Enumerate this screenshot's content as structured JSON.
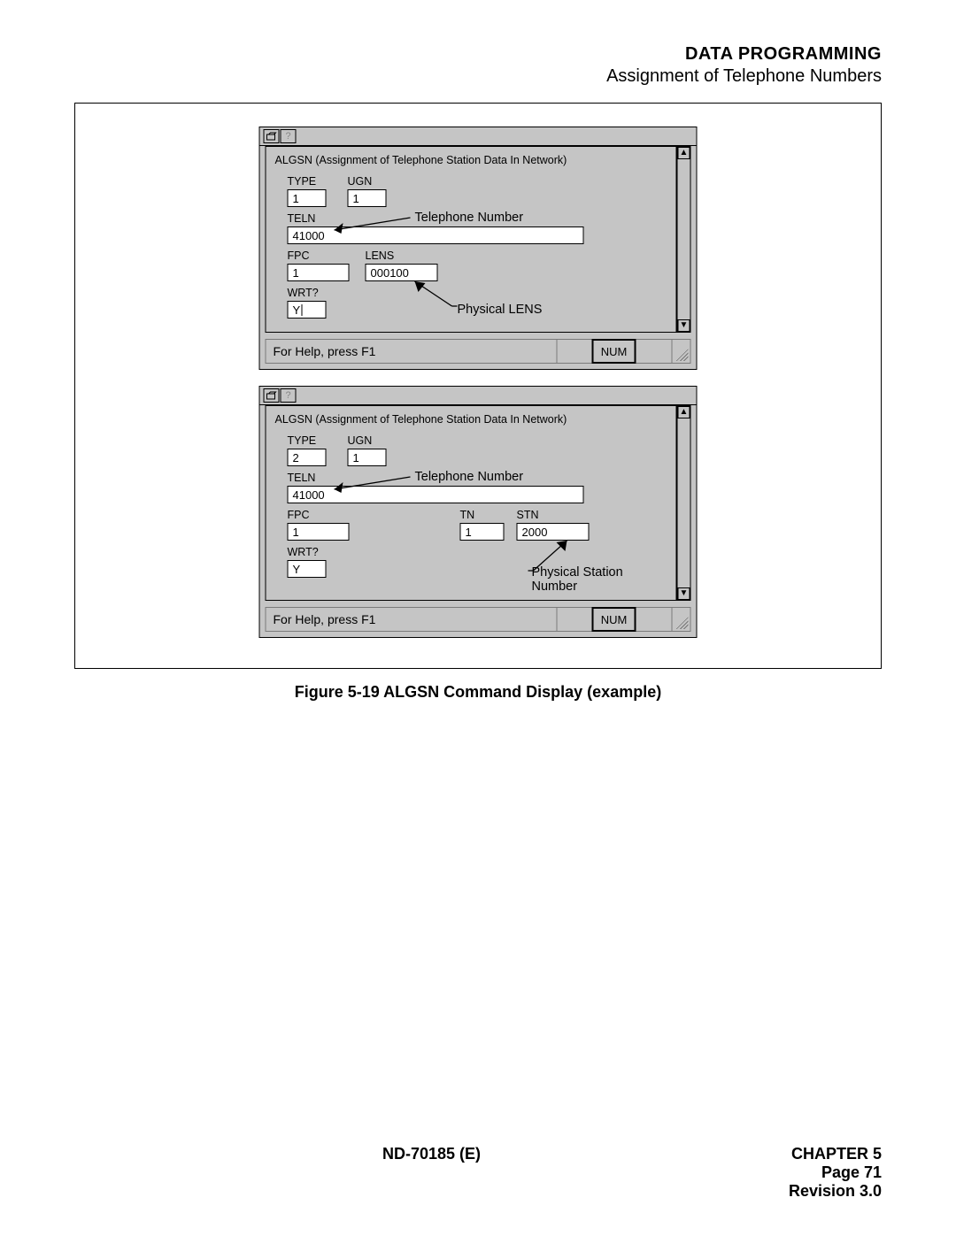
{
  "header": {
    "title": "DATA PROGRAMMING",
    "subtitle": "Assignment of Telephone Numbers"
  },
  "caption": "Figure 5-19    ALGSN Command Display (example)",
  "footer": {
    "doc": "ND-70185 (E)",
    "chapter": "CHAPTER 5",
    "page": "Page 71",
    "rev": "Revision 3.0"
  },
  "win1": {
    "desc": "ALGSN (Assignment of Telephone Station Data In Network)",
    "type_lbl": "TYPE",
    "type": "1",
    "ugn_lbl": "UGN",
    "ugn": "1",
    "teln_lbl": "TELN",
    "teln": "41000",
    "teln_callout": "Telephone Number",
    "fpc_lbl": "FPC",
    "fpc": "1",
    "lens_lbl": "LENS",
    "lens": "000100",
    "lens_callout": "Physical LENS",
    "wrt_lbl": "WRT?",
    "wrt": "Y",
    "help": "For Help, press F1",
    "num": "NUM"
  },
  "win2": {
    "desc": "ALGSN (Assignment of Telephone Station Data In Network)",
    "type_lbl": "TYPE",
    "type": "2",
    "ugn_lbl": "UGN",
    "ugn": "1",
    "teln_lbl": "TELN",
    "teln": "41000",
    "teln_callout": "Telephone Number",
    "fpc_lbl": "FPC",
    "fpc": "1",
    "tn_lbl": "TN",
    "tn": "1",
    "stn_lbl": "STN",
    "stn": "2000",
    "stn_callout": "Physical Station Number",
    "wrt_lbl": "WRT?",
    "wrt": "Y",
    "help": "For Help, press F1",
    "num": "NUM"
  },
  "scroll": {
    "up": "▲",
    "down": "▼"
  }
}
